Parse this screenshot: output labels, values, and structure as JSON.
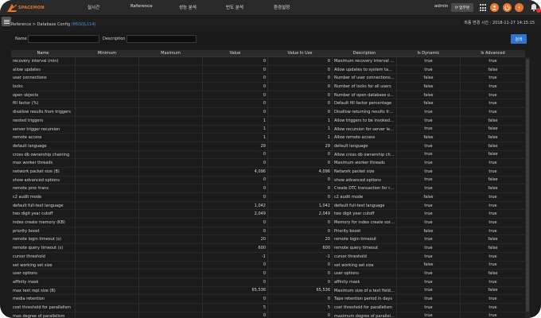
{
  "brand": {
    "name": "SPACEMON"
  },
  "nav": {
    "items": [
      "실시간",
      "Reference",
      "성능 분석",
      "빈도 분석",
      "환경설정"
    ]
  },
  "user": {
    "name": "admin",
    "logout_label": "업무명"
  },
  "icons": [
    "grid-icon",
    "user-icon",
    "power-icon",
    "info-icon",
    "bell-icon"
  ],
  "breadcrumb": {
    "prefix": "Reference > Database Config ",
    "target": "(MSSQL114)"
  },
  "last_modified": "최종 변경 시간 : 2018-11-27 14:15:15",
  "search": {
    "name_label": "Name",
    "name_value": "",
    "description_label": "Description",
    "description_value": "",
    "button_label": "검색"
  },
  "table": {
    "columns": [
      "Name",
      "Minimum",
      "Maximum",
      "Value",
      "Value In Use",
      "Description",
      "Is Dynamic",
      "Is Advanced"
    ],
    "rows": [
      [
        "recovery interval (min)",
        "",
        "",
        "0",
        "0",
        "Maximum recovery interval in m...",
        "true",
        "true"
      ],
      [
        "allow updates",
        "",
        "",
        "0",
        "0",
        "Allow updates to system tables",
        "true",
        "false"
      ],
      [
        "user connections",
        "",
        "",
        "0",
        "0",
        "Number of user connections all...",
        "false",
        "true"
      ],
      [
        "locks",
        "",
        "",
        "0",
        "0",
        "Number of locks for all users",
        "false",
        "true"
      ],
      [
        "open objects",
        "",
        "",
        "0",
        "0",
        "Number of open database objects",
        "false",
        "true"
      ],
      [
        "fill factor (%)",
        "",
        "",
        "0",
        "0",
        "Default fill factor percentage",
        "false",
        "true"
      ],
      [
        "disallow results from triggers",
        "",
        "",
        "0",
        "0",
        "Disallow returning results from t...",
        "true",
        "true"
      ],
      [
        "nested triggers",
        "",
        "",
        "1",
        "1",
        "Allow triggers to be invoked wit...",
        "true",
        "false"
      ],
      [
        "server trigger recursion",
        "",
        "",
        "1",
        "1",
        "Allow recursion for server level t...",
        "true",
        "false"
      ],
      [
        "remote access",
        "",
        "",
        "1",
        "1",
        "Allow remote access",
        "false",
        "false"
      ],
      [
        "default language",
        "",
        "",
        "29",
        "29",
        "default language",
        "true",
        "false"
      ],
      [
        "cross db ownership chaining",
        "",
        "",
        "0",
        "0",
        "Allow cross db ownership chaini...",
        "true",
        "false"
      ],
      [
        "max worker threads",
        "",
        "",
        "0",
        "0",
        "Maximum worker threads",
        "true",
        "true"
      ],
      [
        "network packet size (B)",
        "",
        "",
        "4,096",
        "4,096",
        "Network packet size",
        "true",
        "true"
      ],
      [
        "show advanced options",
        "",
        "",
        "0",
        "0",
        "show advanced options",
        "true",
        "false"
      ],
      [
        "remote proc trans",
        "",
        "",
        "0",
        "0",
        "Create DTC transaction for rem...",
        "true",
        "false"
      ],
      [
        "c2 audit mode",
        "",
        "",
        "0",
        "0",
        "c2 audit mode",
        "false",
        "true"
      ],
      [
        "default full-text language",
        "",
        "",
        "1,042",
        "1,042",
        "default full-text language",
        "true",
        "true"
      ],
      [
        "two digit year cutoff",
        "",
        "",
        "2,049",
        "2,049",
        "two digit year cutoff",
        "true",
        "true"
      ],
      [
        "index create memory (KB)",
        "",
        "",
        "0",
        "0",
        "Memory for index create sorts (...",
        "true",
        "true"
      ],
      [
        "priority boost",
        "",
        "",
        "0",
        "0",
        "Priority boost",
        "false",
        "true"
      ],
      [
        "remote login timeout (s)",
        "",
        "",
        "20",
        "20",
        "remote login timeout",
        "true",
        "false"
      ],
      [
        "remote query timeout (s)",
        "",
        "",
        "600",
        "600",
        "remote query timeout",
        "true",
        "false"
      ],
      [
        "cursor threshold",
        "",
        "",
        "-1",
        "-1",
        "cursor threshold",
        "true",
        "true"
      ],
      [
        "set working set size",
        "",
        "",
        "0",
        "0",
        "set working set size",
        "false",
        "true"
      ],
      [
        "user options",
        "",
        "",
        "0",
        "0",
        "user options",
        "true",
        "false"
      ],
      [
        "affinity mask",
        "",
        "",
        "0",
        "0",
        "affinity mask",
        "true",
        "true"
      ],
      [
        "max text repl size (B)",
        "",
        "",
        "65,536",
        "65,536",
        "Maximum size of a text field in r...",
        "true",
        "false"
      ],
      [
        "media retention",
        "",
        "",
        "0",
        "0",
        "Tape retention period in days",
        "true",
        "true"
      ],
      [
        "cost threshold for parallelism",
        "",
        "",
        "5",
        "5",
        "cost threshold for parallelism",
        "true",
        "true"
      ],
      [
        "max degree of parallelism",
        "",
        "",
        "0",
        "0",
        "maximum degree of parallelism",
        "true",
        "true"
      ]
    ]
  }
}
